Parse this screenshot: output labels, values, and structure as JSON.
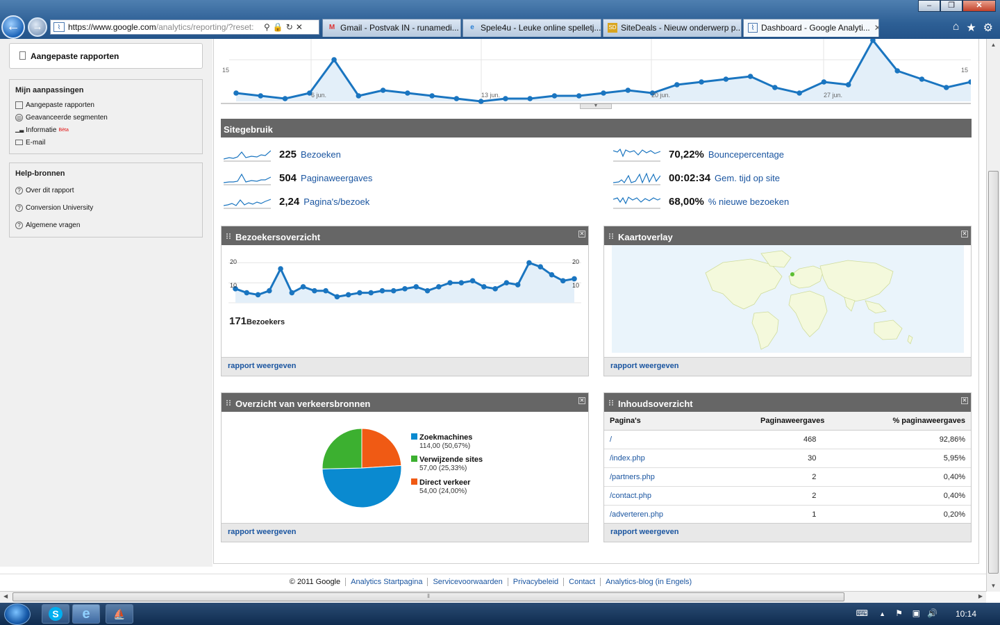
{
  "browser": {
    "url_host": "https://www.google.com",
    "url_path": "/analytics/reporting/?reset:",
    "tabs": [
      {
        "label": "Gmail - Postvak IN - runamedi...",
        "icon": "gmail-icon"
      },
      {
        "label": "Spele4u - Leuke online spelletj...",
        "icon": "ie-icon"
      },
      {
        "label": "SiteDeals - Nieuw onderwerp p...",
        "icon": "sd-icon"
      },
      {
        "label": "Dashboard - Google Analyti...",
        "icon": "analytics-icon",
        "active": true
      }
    ]
  },
  "sidebar": {
    "custom_reports_title": "Aangepaste rapporten",
    "my_customizations": {
      "heading": "Mijn aanpassingen",
      "items": [
        "Aangepaste rapporten",
        "Geavanceerde segmenten",
        "Informatie",
        "E-mail"
      ],
      "beta_label": "Bèta"
    },
    "help": {
      "heading": "Help-bronnen",
      "items": [
        "Over dit rapport",
        "Conversion University",
        "Algemene vragen"
      ]
    }
  },
  "top_chart": {
    "y_label": "15",
    "y_label_right": "15",
    "x_labels": [
      "6 jun.",
      "13 jun.",
      "20 jun.",
      "27 jun."
    ],
    "accent": "#1a75c0"
  },
  "site_usage": {
    "title": "Sitegebruik",
    "metrics": [
      {
        "value": "225",
        "label": "Bezoeken"
      },
      {
        "value": "504",
        "label": "Paginaweergaves"
      },
      {
        "value": "2,24",
        "label": "Pagina's/bezoek"
      },
      {
        "value": "70,22%",
        "label": "Bouncepercentage"
      },
      {
        "value": "00:02:34",
        "label": "Gem. tijd op site"
      },
      {
        "value": "68,00%",
        "label": "% nieuwe bezoeken"
      }
    ]
  },
  "visitors_panel": {
    "title": "Bezoekersoverzicht",
    "y_top": "20",
    "y_mid": "10",
    "y_top_right": "20",
    "y_mid_right": "10",
    "count": "171",
    "count_label": "Bezoekers",
    "link": "rapport weergeven"
  },
  "map_panel": {
    "title": "Kaartoverlay",
    "link": "rapport weergeven"
  },
  "traffic_panel": {
    "title": "Overzicht van verkeersbronnen",
    "link": "rapport weergeven"
  },
  "content_panel": {
    "title": "Inhoudsoverzicht",
    "columns": [
      "Pagina's",
      "Paginaweergaves",
      "% paginaweergaves"
    ],
    "rows": [
      {
        "page": "/",
        "views": "468",
        "pct": "92,86%"
      },
      {
        "page": "/index.php",
        "views": "30",
        "pct": "5,95%"
      },
      {
        "page": "/partners.php",
        "views": "2",
        "pct": "0,40%"
      },
      {
        "page": "/contact.php",
        "views": "2",
        "pct": "0,40%"
      },
      {
        "page": "/adverteren.php",
        "views": "1",
        "pct": "0,20%"
      }
    ],
    "link": "rapport weergeven"
  },
  "footer": {
    "copyright": "© 2011 Google",
    "links": [
      "Analytics Startpagina",
      "Servicevoorwaarden",
      "Privacybeleid",
      "Contact",
      "Analytics-blog (in Engels)"
    ]
  },
  "taskbar": {
    "clock": "10:14"
  },
  "chart_data": [
    {
      "type": "line",
      "series": [
        {
          "values": [
            3,
            2,
            1,
            3,
            15,
            2,
            4,
            3,
            2,
            1,
            0,
            1,
            1,
            2,
            2,
            3,
            4,
            3,
            6,
            7,
            8,
            9,
            5,
            3,
            7,
            6,
            22,
            11,
            8,
            5,
            7
          ]
        }
      ],
      "x_ticks": [
        "6 jun.",
        "13 jun.",
        "20 jun.",
        "27 jun."
      ],
      "ylim": [
        0,
        20
      ]
    },
    {
      "type": "line",
      "series": [
        {
          "values": [
            7,
            5,
            4,
            6,
            17,
            5,
            8,
            6,
            6,
            3,
            4,
            5,
            5,
            6,
            6,
            7,
            8,
            6,
            8,
            10,
            10,
            11,
            8,
            7,
            10,
            9,
            20,
            18,
            14,
            11,
            12
          ]
        }
      ],
      "ylim": [
        0,
        25
      ]
    },
    {
      "type": "pie",
      "slices": [
        {
          "label": "Zoekmachines",
          "value": 114.0,
          "display": "114,00 (50,67%)",
          "color": "#0a8ad0"
        },
        {
          "label": "Verwijzende sites",
          "value": 57.0,
          "display": "57,00 (25,33%)",
          "color": "#3cb030"
        },
        {
          "label": "Direct verkeer",
          "value": 54.0,
          "display": "54,00 (24,00%)",
          "color": "#f05a14"
        }
      ]
    }
  ]
}
